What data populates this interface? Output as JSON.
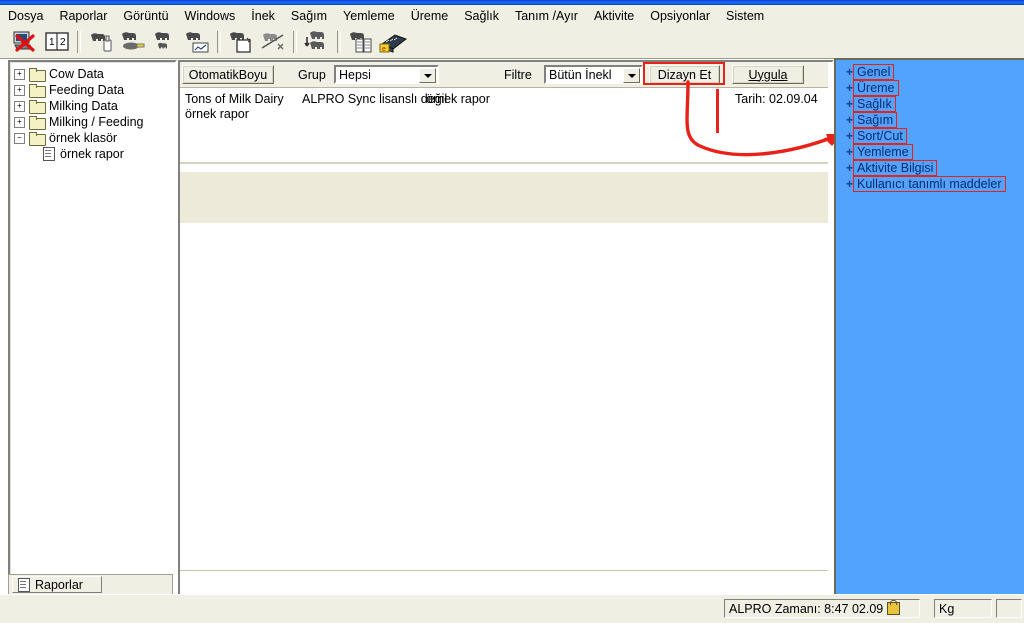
{
  "menubar": {
    "items": [
      {
        "label": "Dosya"
      },
      {
        "label": "Raporlar"
      },
      {
        "label": "Görüntü"
      },
      {
        "label": "Windows"
      },
      {
        "label": "İnek"
      },
      {
        "label": "Sağım"
      },
      {
        "label": "Yemleme"
      },
      {
        "label": "Üreme"
      },
      {
        "label": "Sağlık"
      },
      {
        "label": "Tanım /Ayır"
      },
      {
        "label": "Aktivite"
      },
      {
        "label": "Opsiyonlar"
      },
      {
        "label": "Sistem"
      }
    ]
  },
  "toolbar": {
    "buttons": [
      {
        "icon": "computer-delete-icon"
      },
      {
        "icon": "numbers-book-icon"
      },
      {
        "icon": "cow-bottle-icon"
      },
      {
        "icon": "cow-feed-icon"
      },
      {
        "icon": "cow-calf-icon"
      },
      {
        "icon": "cow-chart-icon"
      },
      {
        "icon": "cow-newpage-icon"
      },
      {
        "icon": "cow-cancel-icon"
      },
      {
        "icon": "cow-group-icon"
      },
      {
        "icon": "cow-report-icon"
      },
      {
        "icon": "keyboard-card-icon"
      }
    ]
  },
  "tree": {
    "nodes": [
      {
        "label": "Cow Data",
        "expander": "+",
        "type": "folder",
        "level": 0
      },
      {
        "label": "Feeding Data",
        "expander": "+",
        "type": "folder",
        "level": 0
      },
      {
        "label": "Milking Data",
        "expander": "+",
        "type": "folder",
        "level": 0
      },
      {
        "label": "Milking / Feeding",
        "expander": "+",
        "type": "folder",
        "level": 0
      },
      {
        "label": "örnek klasör",
        "expander": "−",
        "type": "folder",
        "level": 0
      },
      {
        "label": "örnek rapor",
        "expander": "",
        "type": "document",
        "level": 1
      }
    ],
    "tab_label": "Raporlar",
    "tab_icon": "report-document-icon"
  },
  "report_toolbar": {
    "autosize_label": "OtomatikBoyu",
    "group_label": "Grup",
    "group_value": "Hepsi",
    "filter_label": "Filtre",
    "filter_value": "Bütün İnekl",
    "design_label": "Dizayn Et",
    "apply_label": "Uygula",
    "caret_icon": "chevron-down-icon"
  },
  "report_header": {
    "title": "Tons of Milk Dairy",
    "license_notice": "ALPRO Sync lisanslı değil",
    "report_name": "örnek rapor",
    "subtitle": "örnek rapor",
    "date_label": "Tarih: 02.09.04"
  },
  "right_sidebar": {
    "items": [
      {
        "label": "Genel",
        "expander": "+"
      },
      {
        "label": "Üreme",
        "expander": "+"
      },
      {
        "label": "Sağlık",
        "expander": "+"
      },
      {
        "label": "Sağım",
        "expander": "+"
      },
      {
        "label": "Sort/Cut",
        "expander": "+"
      },
      {
        "label": "Yemleme",
        "expander": "+"
      },
      {
        "label": "Aktivite Bilgisi",
        "expander": "+"
      },
      {
        "label": "Kullanıcı tanımlı maddeler",
        "expander": "+"
      }
    ]
  },
  "statusbar": {
    "time_text": "ALPRO Zamanı: 8:47   02.09",
    "lock_icon": "lock-icon",
    "unit_text": "Kg"
  },
  "annotations": {
    "highlight_color": "#e8211a",
    "arrow_icon": "curved-arrow-icon",
    "sidebar_blue": "#52a3fd"
  }
}
